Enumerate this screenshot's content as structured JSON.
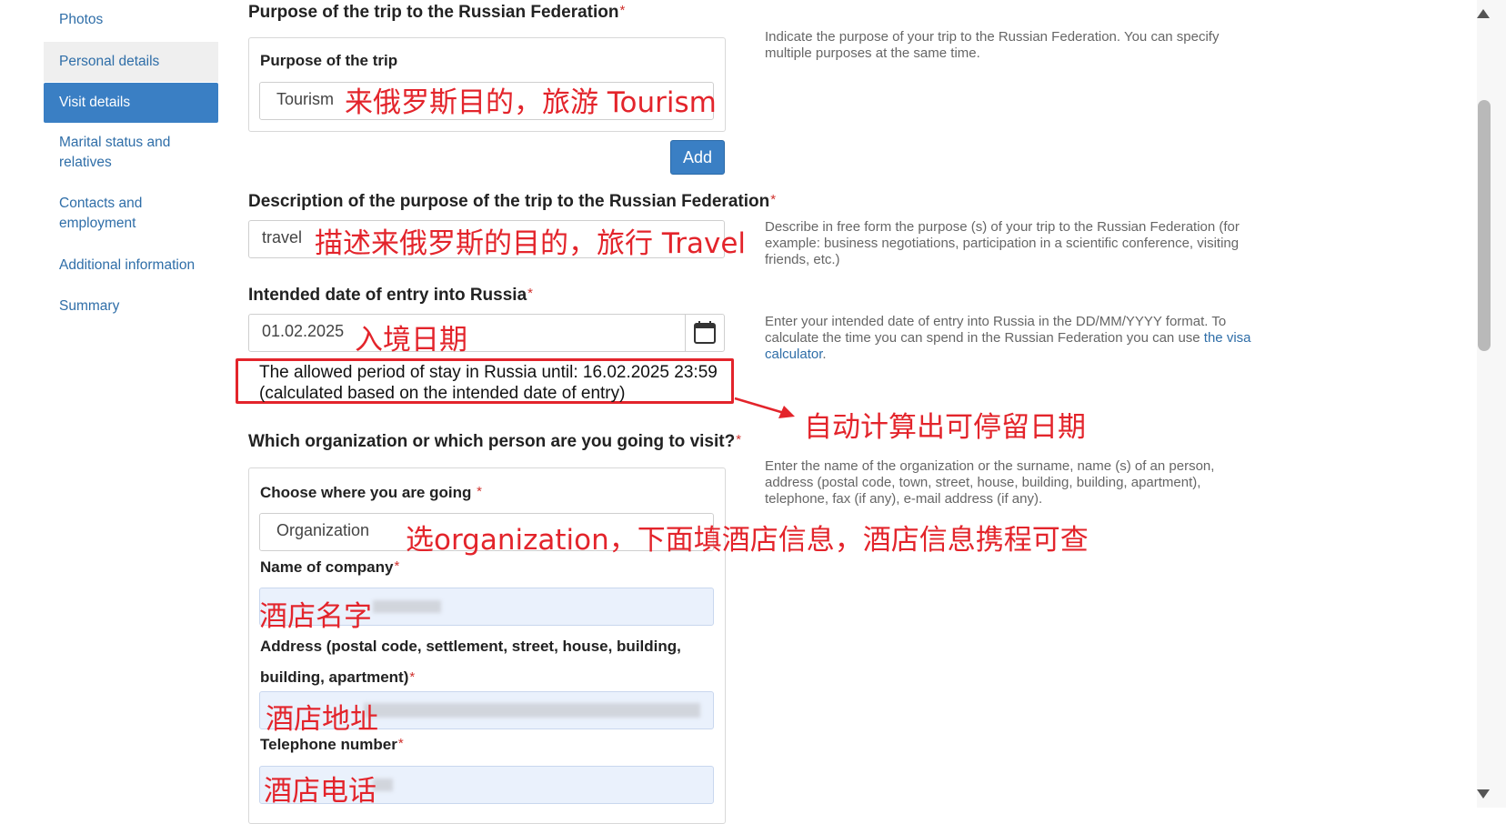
{
  "sidebar": {
    "items": [
      {
        "label": "Photos"
      },
      {
        "label": "Personal details"
      },
      {
        "label": "Visit details"
      },
      {
        "label": "Marital status and relatives"
      },
      {
        "label": "Contacts and employment"
      },
      {
        "label": "Additional information"
      },
      {
        "label": "Summary"
      }
    ]
  },
  "form": {
    "purpose_section_title": "Purpose of the trip to the Russian Federation",
    "purpose_label": "Purpose of the trip",
    "purpose_value": "Tourism",
    "add_label": "Add",
    "description_title": "Description of the purpose of the trip to the Russian Federation",
    "description_value": "travel",
    "entry_date_title": "Intended date of entry into Russia",
    "entry_date_value": "01.02.2025",
    "allowed_period": "The allowed period of stay in Russia until: 16.02.2025 23:59 (calculated based on the intended date of entry)",
    "visit_title": "Which organization or which person are you going to visit?",
    "choose_label": "Choose where you are going",
    "choose_value": "Organization",
    "company_label": "Name of company",
    "address_label": "Address (postal code, settlement, street, house, building, building, apartment)",
    "telephone_label": "Telephone number",
    "required_mark": "*"
  },
  "help": {
    "purpose": "Indicate the purpose of your trip to the Russian Federation. You can specify multiple purposes at the same time.",
    "description": "Describe in free form the purpose (s) of your trip to the Russian Federation (for example: business negotiations, participation in a scientific conference, visiting friends, etc.)",
    "entry_date_text": "Enter your intended date of entry into Russia in the DD/MM/YYYY format. To calculate the time you can spend in the Russian Federation you can use",
    "entry_date_link": "the visa calculator",
    "visit": "Enter the name of the organization or the surname, name (s) of an person, address (postal code, town, street, house, building, building, apartment), telephone, fax (if any), e-mail address (if any)."
  },
  "annotations": {
    "purpose": "来俄罗斯目的，旅游 Tourism",
    "description": "描述来俄罗斯的目的，旅行 Travel",
    "entry_date": "入境日期",
    "auto_calc": "自动计算出可停留日期",
    "organization": "选organization，下面填酒店信息，酒店信息携程可查",
    "hotel_name": "酒店名字",
    "hotel_address": "酒店地址",
    "hotel_phone": "酒店电话"
  },
  "colors": {
    "accent": "#3a7fc4",
    "annotation": "#e3242b",
    "required": "#d0312d"
  }
}
